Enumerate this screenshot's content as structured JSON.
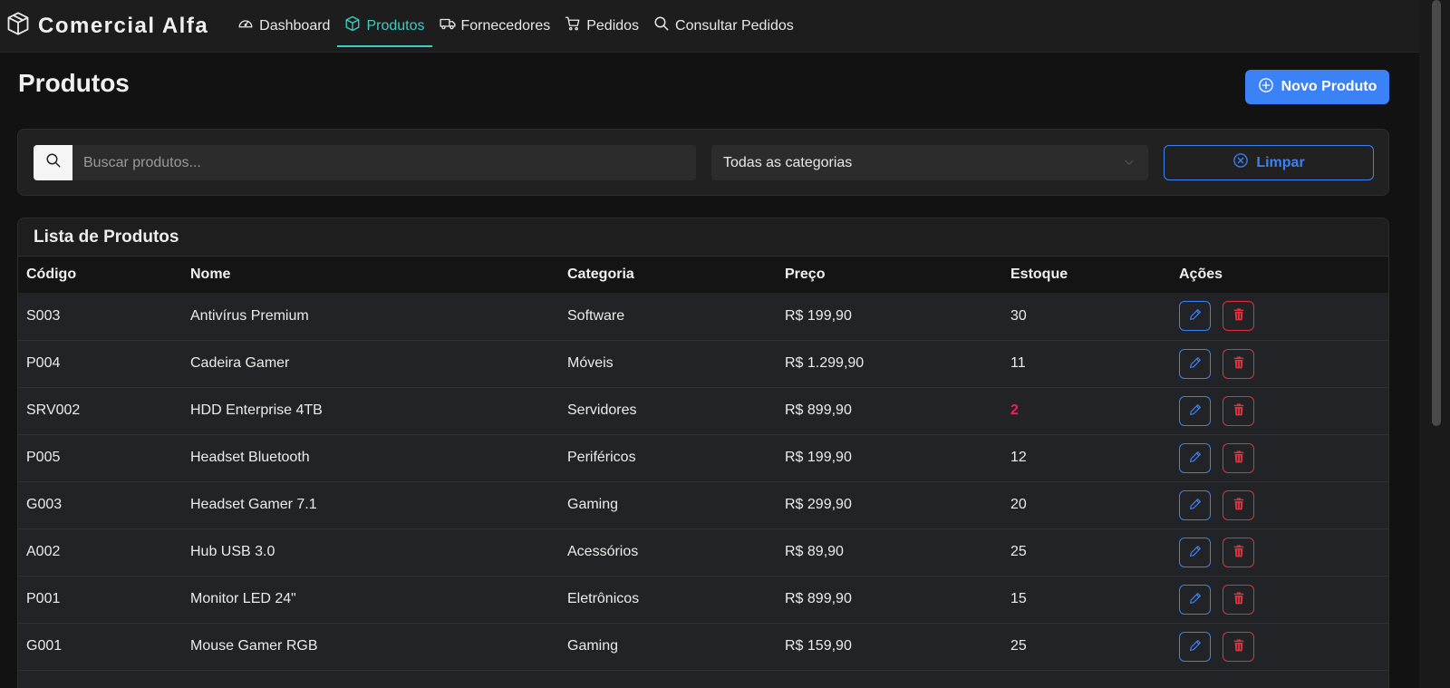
{
  "brand": {
    "name": "Comercial Alfa",
    "icon": "box-icon"
  },
  "nav": [
    {
      "label": "Dashboard",
      "icon": "speedometer-icon",
      "active": false
    },
    {
      "label": "Produtos",
      "icon": "box-icon",
      "active": true
    },
    {
      "label": "Fornecedores",
      "icon": "truck-icon",
      "active": false
    },
    {
      "label": "Pedidos",
      "icon": "cart-icon",
      "active": false
    },
    {
      "label": "Consultar Pedidos",
      "icon": "search-icon",
      "active": false
    }
  ],
  "page": {
    "title": "Produtos",
    "new_button": "Novo Produto"
  },
  "filters": {
    "search_placeholder": "Buscar produtos...",
    "search_value": "",
    "category_selected": "Todas as categorias",
    "clear_label": "Limpar"
  },
  "table": {
    "title": "Lista de Produtos",
    "headers": [
      "Código",
      "Nome",
      "Categoria",
      "Preço",
      "Estoque",
      "Ações"
    ],
    "rows": [
      {
        "code": "S003",
        "name": "Antivírus Premium",
        "category": "Software",
        "price": "R$ 199,90",
        "stock": "30",
        "low": false
      },
      {
        "code": "P004",
        "name": "Cadeira Gamer",
        "category": "Móveis",
        "price": "R$ 1.299,90",
        "stock": "11",
        "low": false
      },
      {
        "code": "SRV002",
        "name": "HDD Enterprise 4TB",
        "category": "Servidores",
        "price": "R$ 899,90",
        "stock": "2",
        "low": true
      },
      {
        "code": "P005",
        "name": "Headset Bluetooth",
        "category": "Periféricos",
        "price": "R$ 199,90",
        "stock": "12",
        "low": false
      },
      {
        "code": "G003",
        "name": "Headset Gamer 7.1",
        "category": "Gaming",
        "price": "R$ 299,90",
        "stock": "20",
        "low": false
      },
      {
        "code": "A002",
        "name": "Hub USB 3.0",
        "category": "Acessórios",
        "price": "R$ 89,90",
        "stock": "25",
        "low": false
      },
      {
        "code": "P001",
        "name": "Monitor LED 24\"",
        "category": "Eletrônicos",
        "price": "R$ 899,90",
        "stock": "15",
        "low": false
      },
      {
        "code": "G001",
        "name": "Mouse Gamer RGB",
        "category": "Gaming",
        "price": "R$ 159,90",
        "stock": "25",
        "low": false
      }
    ]
  },
  "colors": {
    "accent_teal": "#3ecdc3",
    "primary_blue": "#3b82f6",
    "danger_red": "#e0323d",
    "low_stock": "#e8245a"
  }
}
